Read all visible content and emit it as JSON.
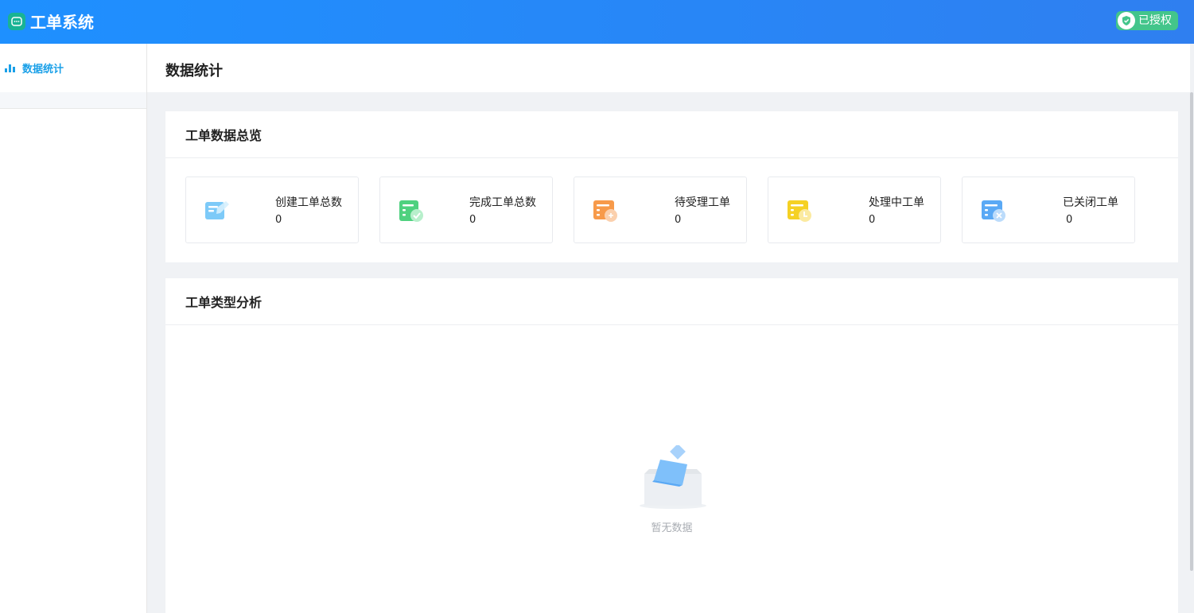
{
  "app": {
    "title": "工单系统",
    "license_label": "已授权"
  },
  "sidebar": {
    "items": [
      {
        "label": "数据统计",
        "icon": "bar-chart-icon"
      }
    ]
  },
  "page": {
    "title": "数据统计"
  },
  "overview": {
    "title": "工单数据总览",
    "stats": [
      {
        "label": "创建工单总数",
        "value": "0",
        "icon": "created-ticket-icon",
        "color": "#5bbcf5"
      },
      {
        "label": "完成工单总数",
        "value": "0",
        "icon": "completed-ticket-icon",
        "color": "#4fd17f"
      },
      {
        "label": "待受理工单",
        "value": "0",
        "icon": "pending-ticket-icon",
        "color": "#f79a4a"
      },
      {
        "label": "处理中工单",
        "value": "0",
        "icon": "processing-ticket-icon",
        "color": "#f5d124"
      },
      {
        "label": "已关闭工单",
        "value": "0",
        "icon": "closed-ticket-icon",
        "color": "#5aa9f5"
      }
    ]
  },
  "type_analysis": {
    "title": "工单类型分析",
    "empty_text": "暂无数据"
  },
  "colors": {
    "header_start": "#1e90ff",
    "header_end": "#2f7ff0",
    "accent": "#1aa0e8",
    "license": "#43c58b"
  }
}
